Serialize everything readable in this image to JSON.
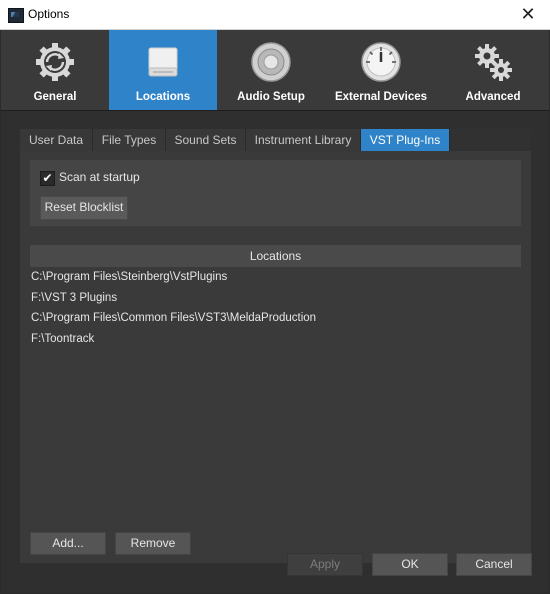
{
  "window": {
    "title": "Options"
  },
  "categories": [
    {
      "label": "General",
      "icon": "gear-sync-icon",
      "active": false
    },
    {
      "label": "Locations",
      "icon": "drive-icon",
      "active": true
    },
    {
      "label": "Audio Setup",
      "icon": "speaker-icon",
      "active": false
    },
    {
      "label": "External Devices",
      "icon": "dial-icon",
      "active": false
    },
    {
      "label": "Advanced",
      "icon": "gears-icon",
      "active": false
    }
  ],
  "subtabs": [
    {
      "label": "User Data",
      "active": false
    },
    {
      "label": "File Types",
      "active": false
    },
    {
      "label": "Sound Sets",
      "active": false
    },
    {
      "label": "Instrument Library",
      "active": false
    },
    {
      "label": "VST Plug-Ins",
      "active": true
    }
  ],
  "vst": {
    "scan_label": "Scan at startup",
    "scan_checked": true,
    "reset_label": "Reset Blocklist",
    "locations_header": "Locations",
    "locations": [
      "C:\\Program Files\\Steinberg\\VstPlugins",
      "F:\\VST 3 Plugins",
      "C:\\Program Files\\Common Files\\VST3\\MeldaProduction",
      "F:\\Toontrack"
    ],
    "add_label": "Add...",
    "remove_label": "Remove"
  },
  "footer": {
    "apply_label": "Apply",
    "ok_label": "OK",
    "cancel_label": "Cancel"
  },
  "colors": {
    "accent": "#2f84c9",
    "background": "#2f2f2f",
    "panel": "#3a3a3a"
  }
}
